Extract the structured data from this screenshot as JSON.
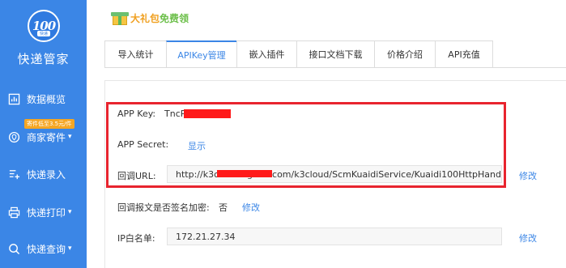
{
  "sidebar": {
    "logo_number": "100",
    "logo_sub": "快递",
    "brand": "快递管家",
    "items": [
      {
        "label": "数据概览",
        "icon": "chart-icon"
      },
      {
        "label": "商家寄件",
        "icon": "location-icon",
        "badge": "寄件低至3.5元/件"
      },
      {
        "label": "快递录入",
        "icon": "form-add-icon"
      },
      {
        "label": "快递打印",
        "icon": "printer-icon"
      },
      {
        "label": "快递查询",
        "icon": "search-icon"
      }
    ]
  },
  "promo": {
    "part1": "大礼包",
    "part2": "免费领"
  },
  "tabs": [
    {
      "label": "导入统计",
      "active": false
    },
    {
      "label": "APIKey管理",
      "active": true
    },
    {
      "label": "嵌入插件",
      "active": false
    },
    {
      "label": "接口文档下载",
      "active": false
    },
    {
      "label": "价格介绍",
      "active": false
    },
    {
      "label": "API充值",
      "active": false
    }
  ],
  "api": {
    "app_key_label": "APP Key:",
    "app_key_value": "TncP",
    "app_secret_label": "APP Secret:",
    "app_secret_action": "显示",
    "callback_label": "回调URL:",
    "callback_url_prefix": "http://k3c",
    "callback_url_suffix": "ngdee.com/k3cloud/ScmKuaidiService/Kuaidi100HttpHand",
    "callback_edit": "修改",
    "sign_label": "回调报文是否签名加密:",
    "sign_value": "否",
    "sign_edit": "修改",
    "ip_label": "IP白名单:",
    "ip_value": "172.21.27.34",
    "ip_edit": "修改"
  },
  "colors": {
    "primary": "#3b86e6",
    "highlight": "#e8242e",
    "redaction": "#ff1a1a",
    "badge": "#f5a623"
  }
}
